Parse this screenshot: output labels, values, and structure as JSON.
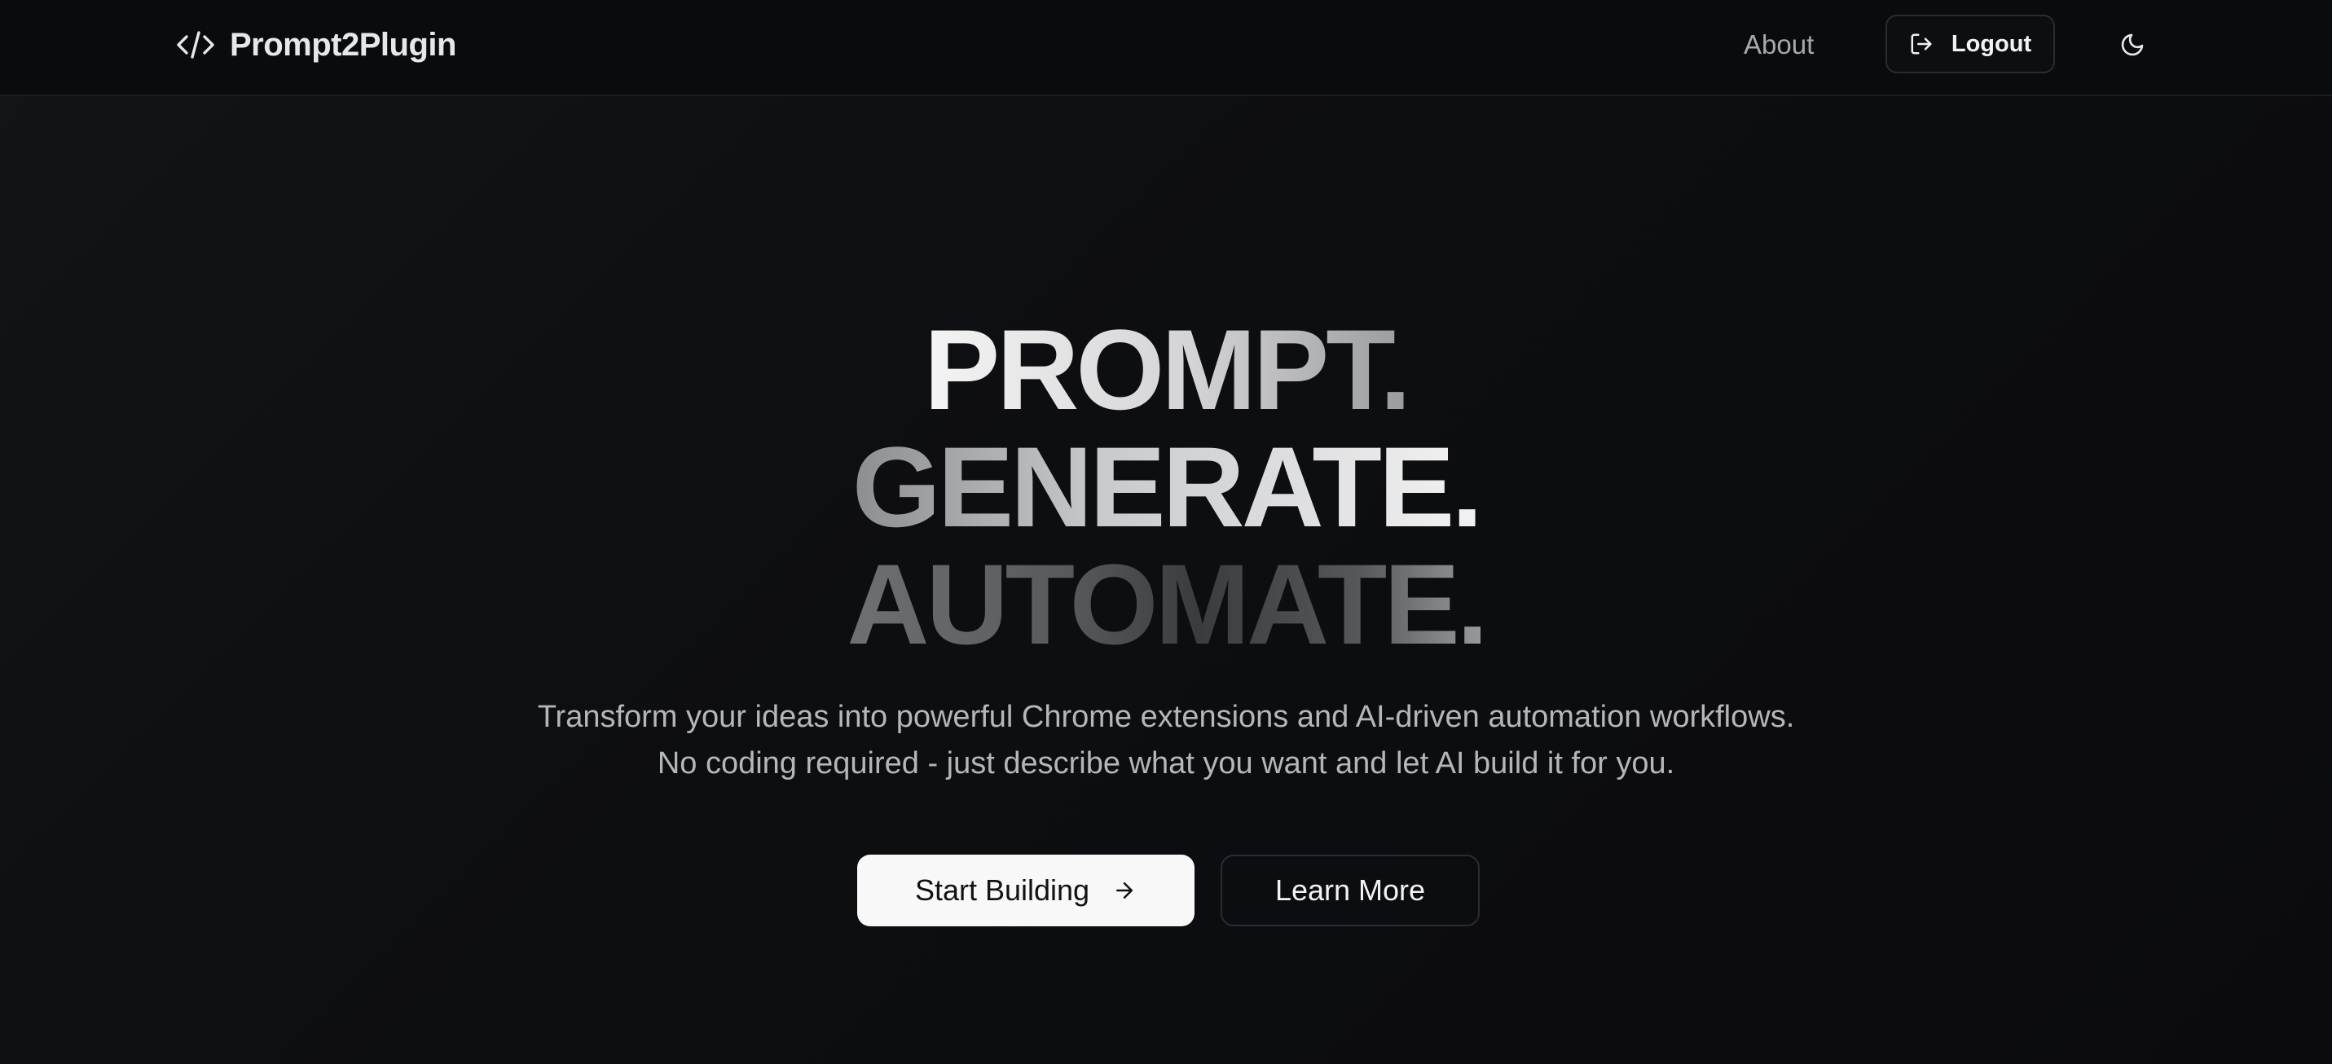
{
  "brand": {
    "name": "Prompt2Plugin",
    "icon": "code-brackets-icon"
  },
  "nav": {
    "about_label": "About",
    "logout_label": "Logout",
    "logout_icon": "logout-icon",
    "theme_icon": "moon-icon"
  },
  "hero": {
    "line1": "PROMPT.",
    "line2": "GENERATE.",
    "line3": "AUTOMATE.",
    "subtitle": "Transform your ideas into powerful Chrome extensions and AI-driven automation workflows. No coding required - just describe what you want and let AI build it for you.",
    "primary_button": "Start Building",
    "primary_button_icon": "arrow-right-icon",
    "secondary_button": "Learn More"
  },
  "colors": {
    "background": "#0b0c0e",
    "primary_button_bg": "#f8f8f9",
    "text_muted": "#b4b6ba"
  }
}
